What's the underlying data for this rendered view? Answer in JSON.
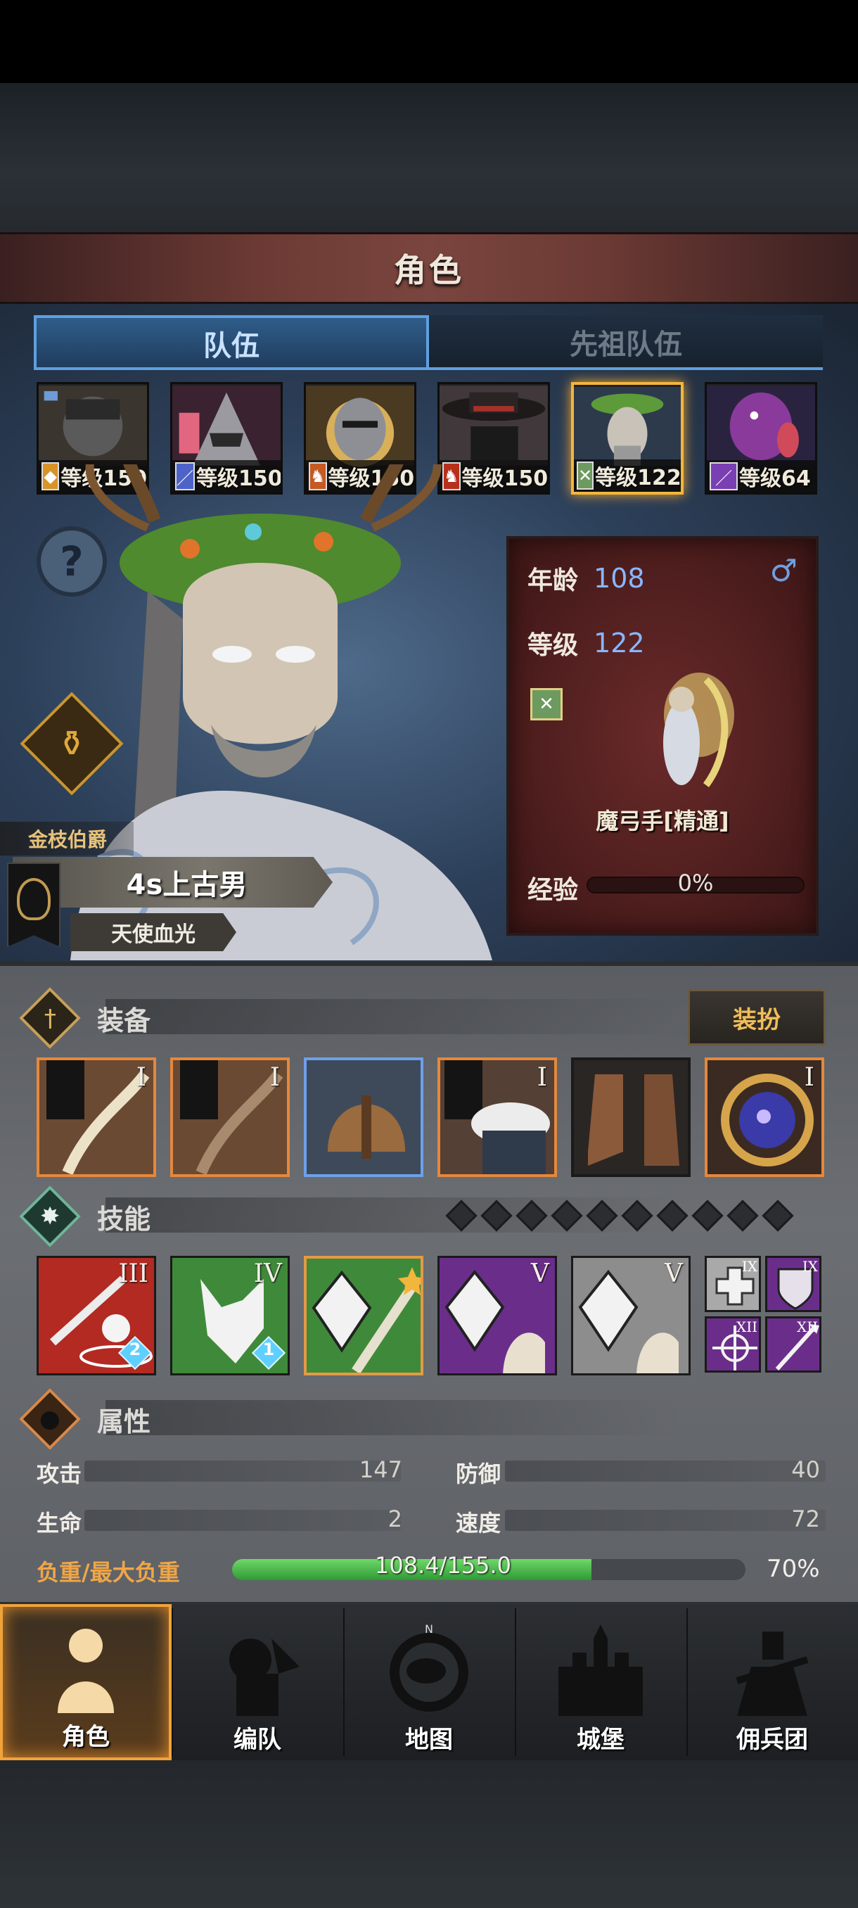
{
  "header": {
    "title": "角色"
  },
  "tabs": [
    {
      "label": "队伍",
      "active": true
    },
    {
      "label": "先祖队伍",
      "active": false
    }
  ],
  "heroes": [
    {
      "level": "等级150",
      "class_icon": "shield-icon",
      "badge_color": "#d8932a"
    },
    {
      "level": "等级150",
      "class_icon": "sword-icon",
      "badge_color": "#4d63c9"
    },
    {
      "level": "等级150",
      "class_icon": "horse-icon",
      "badge_color": "#c55a24"
    },
    {
      "level": "等级150",
      "class_icon": "horse-icon",
      "badge_color": "#b7301c"
    },
    {
      "level": "等级122",
      "class_icon": "bow-icon",
      "badge_color": "#6d9a5f",
      "selected": true
    },
    {
      "level": "等级64",
      "class_icon": "staff-icon",
      "badge_color": "#7a3fb3"
    }
  ],
  "character": {
    "title": "金枝伯爵",
    "name": "4s上古男",
    "trait": "天使血光",
    "age_label": "年龄",
    "age": "108",
    "level_label": "等级",
    "level": "122",
    "gender_icon": "male-icon",
    "class_name": "魔弓手[精通]",
    "exp_label": "经验",
    "exp_percent": "0%"
  },
  "equipment": {
    "title": "装备",
    "dress_button": "装扮",
    "slots": [
      {
        "name": "bow-weapon",
        "tier": "I",
        "rarity": "orange"
      },
      {
        "name": "bow-weapon-secondary",
        "tier": "I",
        "rarity": "orange"
      },
      {
        "name": "helmet",
        "tier": "",
        "rarity": "blue"
      },
      {
        "name": "fur-armor",
        "tier": "I",
        "rarity": "orange"
      },
      {
        "name": "boots",
        "tier": "",
        "rarity": "none"
      },
      {
        "name": "astrolabe-accessory",
        "tier": "I",
        "rarity": "orange"
      }
    ]
  },
  "skills": {
    "title": "技能",
    "pip_count": 10,
    "slots": [
      {
        "name": "sword-strike",
        "tier": "III",
        "gem": "2",
        "color": "#b22a22"
      },
      {
        "name": "wolf-spirit",
        "tier": "IV",
        "gem": "1",
        "color": "#3f8a3a"
      },
      {
        "name": "crystal-arrow",
        "tier": "",
        "gem": "",
        "color": "#3f8a3a"
      },
      {
        "name": "crystal-hand-purple",
        "tier": "V",
        "gem": "",
        "color": "#6a2e8a"
      },
      {
        "name": "crystal-hand-grey",
        "tier": "V",
        "gem": "",
        "color": "#8d8d8d"
      }
    ],
    "mini": [
      {
        "name": "heal-cross",
        "tier": "IX",
        "color": "#a9a9a9"
      },
      {
        "name": "shield",
        "tier": "IX",
        "color": "#6a2e8a"
      },
      {
        "name": "compass-star",
        "tier": "XII",
        "color": "#6a2e8a"
      },
      {
        "name": "spear",
        "tier": "XII",
        "color": "#6a2e8a"
      }
    ]
  },
  "attributes": {
    "title": "属性",
    "attack_label": "攻击",
    "attack": "147",
    "defense_label": "防御",
    "defense": "40",
    "hp_label": "生命",
    "hp": "2",
    "speed_label": "速度",
    "speed": "72",
    "load_label": "负重/最大负重",
    "load_value": "108.4/155.0",
    "load_percent": "70%",
    "load_fraction": 0.7
  },
  "nav": [
    {
      "label": "角色",
      "active": true
    },
    {
      "label": "编队",
      "active": false
    },
    {
      "label": "地图",
      "active": false
    },
    {
      "label": "城堡",
      "active": false
    },
    {
      "label": "佣兵团",
      "active": false
    }
  ],
  "compass_letter": "N"
}
